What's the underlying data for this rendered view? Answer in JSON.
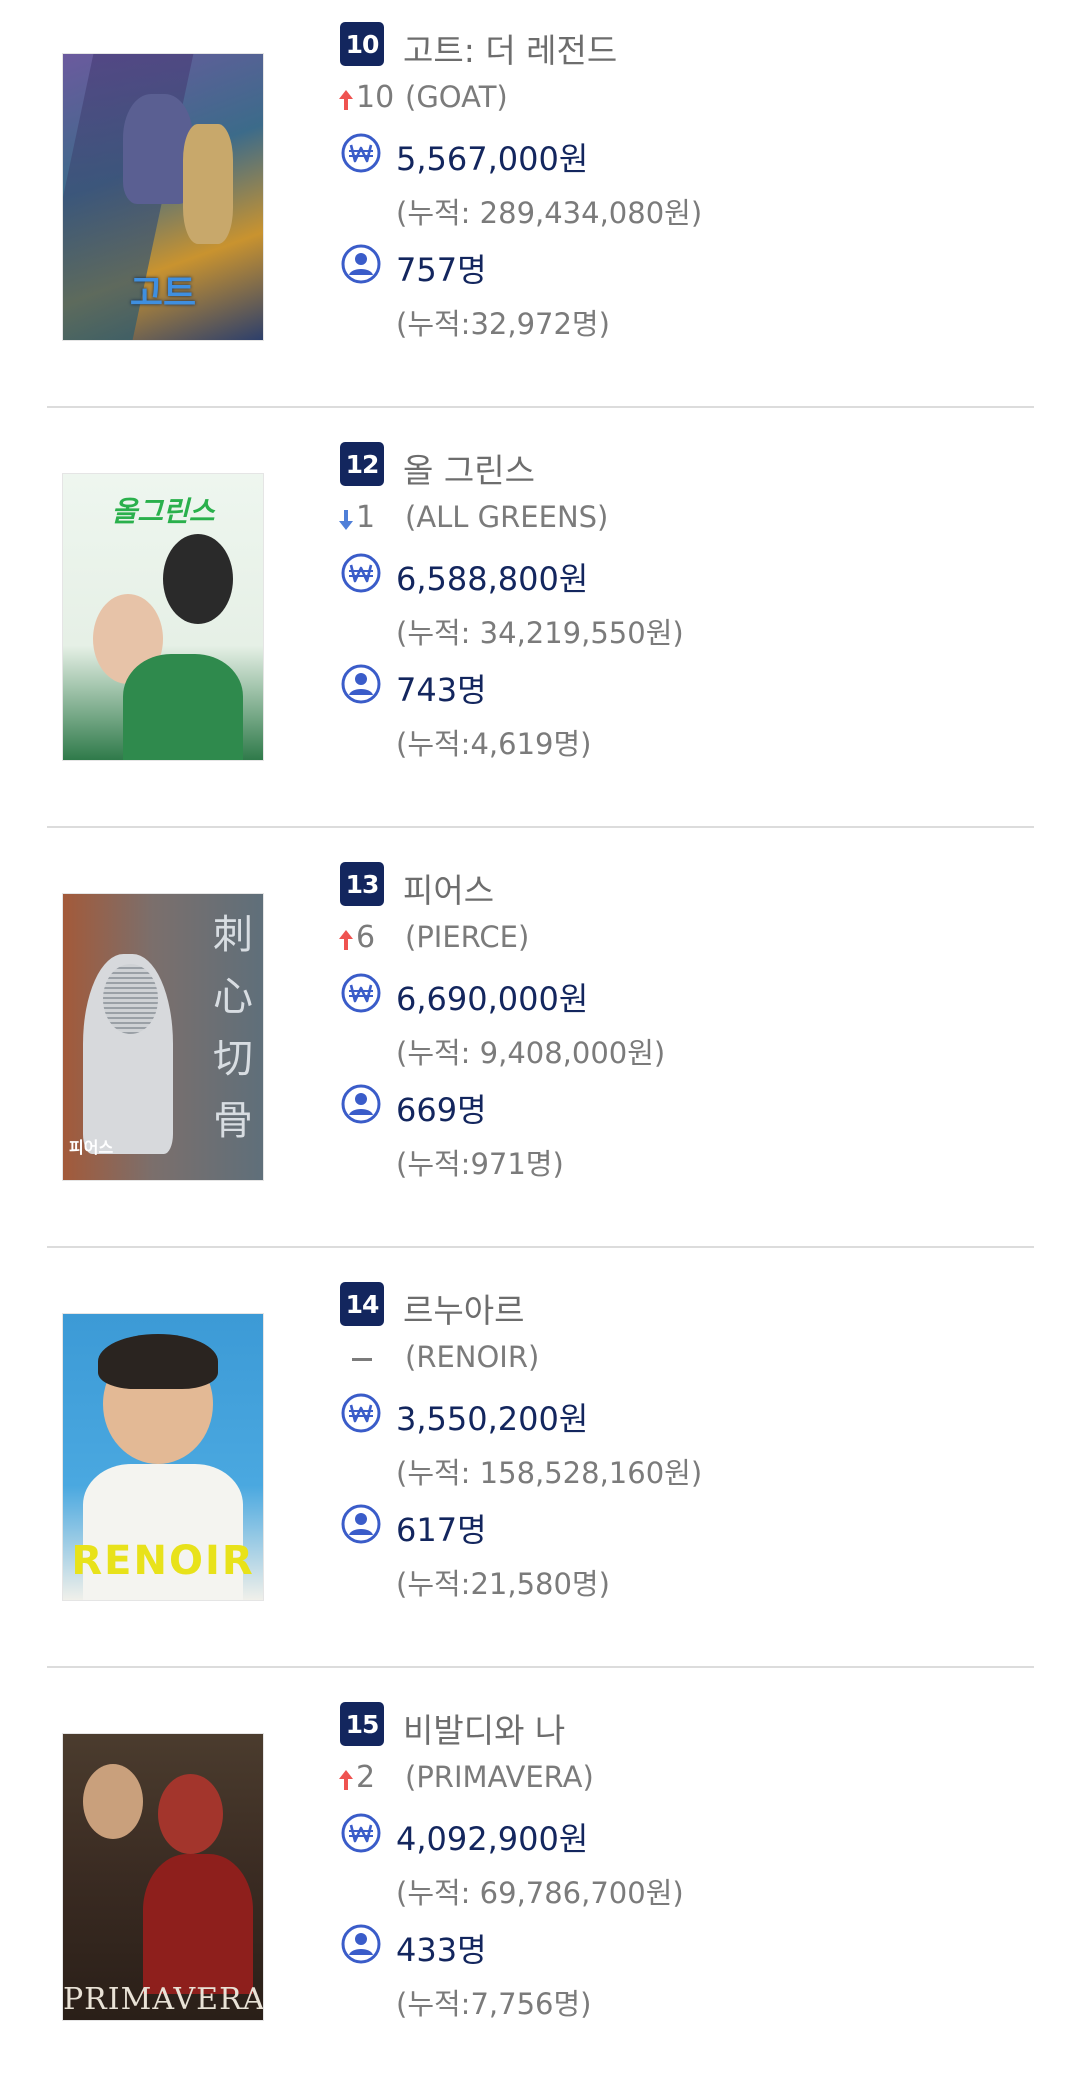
{
  "colors": {
    "rank_bg": "#13265e",
    "value_text": "#13265e",
    "up_arrow": "#ef5350",
    "down_arrow": "#4f7fd8",
    "icon": "#3a5cc9",
    "divider": "#dcdcdc"
  },
  "icons": {
    "sales": "won-circle-icon",
    "audience": "person-circle-icon"
  },
  "movies": [
    {
      "rank": "10",
      "title": "고트: 더 레전드",
      "change_dir": "up",
      "change": "10",
      "original_title": "(GOAT)",
      "sales": "5,567,000원",
      "sales_cum": "(누적: 289,434,080원)",
      "audience": "757명",
      "audience_cum": "(누적:32,972명)",
      "poster_text": "고트"
    },
    {
      "rank": "12",
      "title": "올 그린스",
      "change_dir": "down",
      "change": "1",
      "original_title": "(ALL GREENS)",
      "sales": "6,588,800원",
      "sales_cum": "(누적: 34,219,550원)",
      "audience": "743명",
      "audience_cum": "(누적:4,619명)",
      "poster_text": "올그린스"
    },
    {
      "rank": "13",
      "title": "피어스",
      "change_dir": "up",
      "change": "6",
      "original_title": "(PIERCE)",
      "sales": "6,690,000원",
      "sales_cum": "(누적: 9,408,000원)",
      "audience": "669명",
      "audience_cum": "(누적:971명)",
      "poster_text": "피어스"
    },
    {
      "rank": "14",
      "title": "르누아르",
      "change_dir": "none",
      "change": "",
      "original_title": "(RENOIR)",
      "sales": "3,550,200원",
      "sales_cum": "(누적: 158,528,160원)",
      "audience": "617명",
      "audience_cum": "(누적:21,580명)",
      "poster_text": "RENOIR"
    },
    {
      "rank": "15",
      "title": "비발디와 나",
      "change_dir": "up",
      "change": "2",
      "original_title": "(PRIMAVERA)",
      "sales": "4,092,900원",
      "sales_cum": "(누적: 69,786,700원)",
      "audience": "433명",
      "audience_cum": "(누적:7,756명)",
      "poster_text": "PRIMAVERA"
    }
  ]
}
